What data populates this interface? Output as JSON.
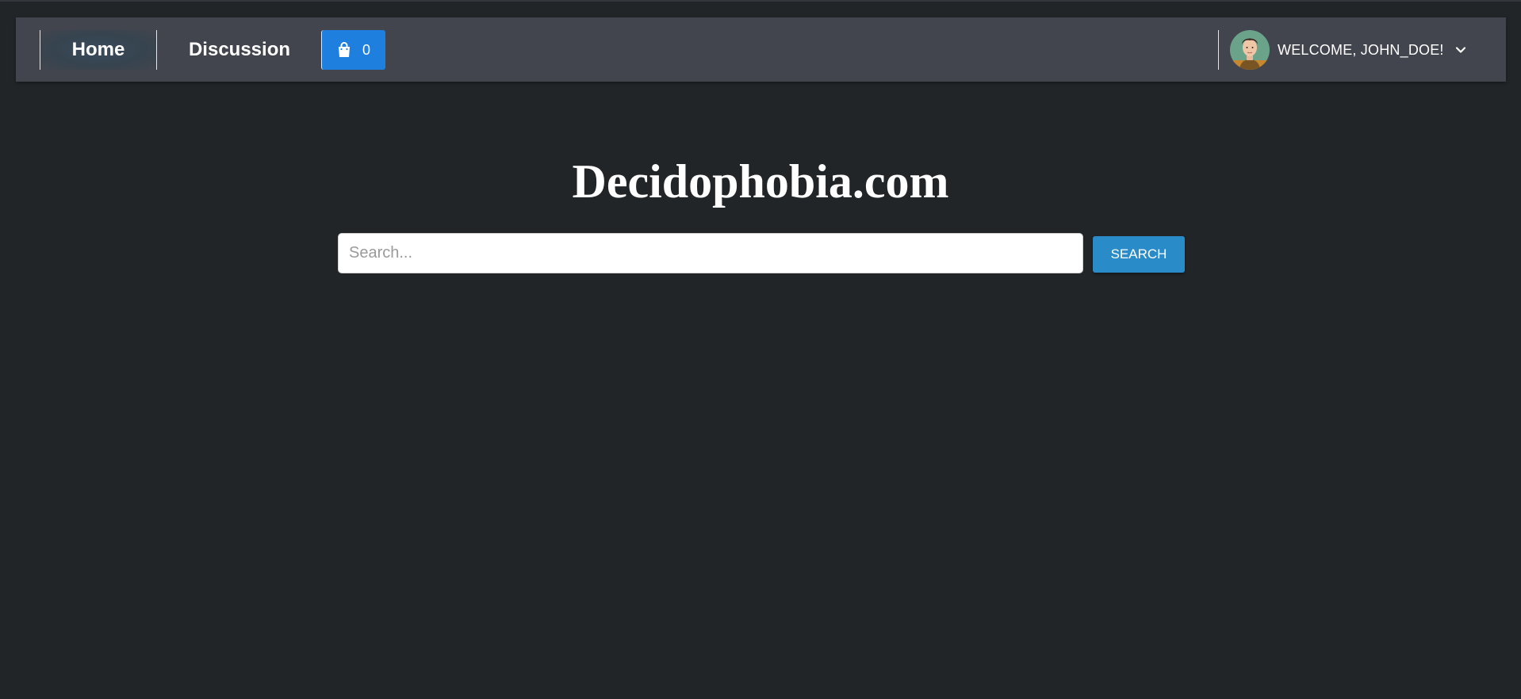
{
  "nav": {
    "home_label": "Home",
    "discussion_label": "Discussion",
    "cart_count": "0",
    "cart_icon": "shopping-bag-icon"
  },
  "user": {
    "welcome_text": "WELCOME, JOHN_DOE!",
    "dropdown_icon": "chevron-down-icon"
  },
  "main": {
    "site_title": "Decidophobia.com",
    "search_placeholder": "Search...",
    "search_value": "",
    "search_button_label": "SEARCH"
  },
  "colors": {
    "background": "#222528",
    "navbar": "#42454e",
    "cart_button": "#1f7fde",
    "search_button": "#2a8bc9"
  }
}
